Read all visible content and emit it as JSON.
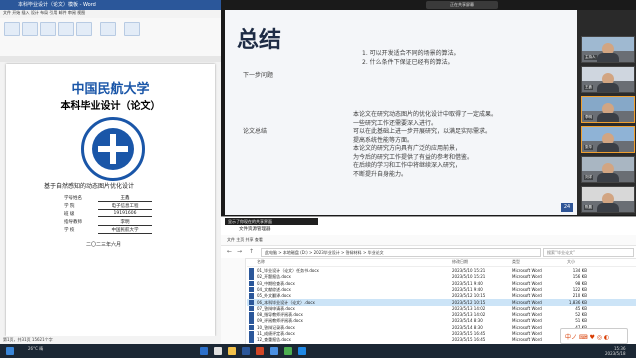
{
  "word": {
    "title": "本科毕业设计（论文）模板 - Word",
    "tabs": "文件 开始 插入 设计 布局 引用 邮件 审阅 视图",
    "university": "中国民航大学",
    "thesis_heading": "本科毕业设计（论文）",
    "doc_title": "基于自然感知的动态图片优化设计",
    "info": [
      {
        "label": "学号姓名",
        "value": "王鑫"
      },
      {
        "label": "学    院",
        "value": "电子信息工程"
      },
      {
        "label": "班    级",
        "value": "19191606"
      },
      {
        "label": "指导教师",
        "value": "李明"
      },
      {
        "label": "学    校",
        "value": "中国民航大学"
      }
    ],
    "date": "二〇二三年六月",
    "status": "第1页，共31页  15621个字"
  },
  "presentation": {
    "indicator": "正在共享屏幕",
    "slide_title": "总结",
    "label_1": "下一步问题",
    "bullets": [
      "1. 可以开发适合不同的场景的算法。",
      "2. 什么条件下保证已经有的算法。"
    ],
    "label_2": "论文总结",
    "para": [
      "本论文在研究动态图片的优化设计中取得了一定成果。",
      "一些研究工作还需要深入进行。",
      "可以在此基础上进一步开展研究，以满足实际需求。",
      "提高系统性能等方面。",
      "本论文的研究方向具有广泛的应用前景，",
      "为今后的研究工作提供了有益的参考和借鉴。",
      "在后续的学习和工作中将继续深入研究，",
      "不断提升自身能力。"
    ],
    "page_num": "24",
    "participants": [
      "主持人",
      "王鑫",
      "李明",
      "张华",
      "刘洋",
      "陈晨"
    ]
  },
  "explorer": {
    "tooltip": "显示了你现在的共享界面",
    "title": "文件资源管理器",
    "tabs": "文件 主页 共享 查看",
    "address": "此电脑 > 本地磁盘 (D:) > 2023毕业设计 > 答辩材料 > 毕业论文",
    "search_placeholder": "搜索“毕业论文”",
    "headers": {
      "name": "名称",
      "date": "修改日期",
      "type": "类型",
      "size": "大小"
    },
    "files": [
      {
        "name": "01_毕业设计（论文）任务书.docx",
        "date": "2023/5/10 15:21",
        "type": "Microsoft Word",
        "size": "134 KB"
      },
      {
        "name": "02_开题报告.docx",
        "date": "2023/5/10 15:21",
        "type": "Microsoft Word",
        "size": "156 KB"
      },
      {
        "name": "03_中期检查表.docx",
        "date": "2023/5/11 9:40",
        "type": "Microsoft Word",
        "size": "98 KB"
      },
      {
        "name": "04_文献综述.docx",
        "date": "2023/5/11 9:40",
        "type": "Microsoft Word",
        "size": "122 KB"
      },
      {
        "name": "05_外文翻译.docx",
        "date": "2023/5/12 10:15",
        "type": "Microsoft Word",
        "size": "210 KB"
      },
      {
        "name": "06_本科毕业设计（论文）.docx",
        "date": "2023/5/12 10:15",
        "type": "Microsoft Word",
        "size": "1,836 KB"
      },
      {
        "name": "07_答辩申请表.docx",
        "date": "2023/5/13 14:02",
        "type": "Microsoft Word",
        "size": "45 KB"
      },
      {
        "name": "08_指导教师评阅表.docx",
        "date": "2023/5/13 14:02",
        "type": "Microsoft Word",
        "size": "52 KB"
      },
      {
        "name": "09_评阅教师评阅表.docx",
        "date": "2023/5/14 8:30",
        "type": "Microsoft Word",
        "size": "51 KB"
      },
      {
        "name": "10_答辩记录表.docx",
        "date": "2023/5/14 8:30",
        "type": "Microsoft Word",
        "size": "47 KB"
      },
      {
        "name": "11_成绩评定表.docx",
        "date": "2023/5/15 16:45",
        "type": "Microsoft Word",
        "size": "49 KB"
      },
      {
        "name": "12_查重报告.docx",
        "date": "2023/5/15 16:45",
        "type": "Microsoft Word",
        "size": "300 KB"
      }
    ],
    "selected_index": 5
  },
  "taskbar": {
    "weather": "26°C 晴",
    "time": "15:36",
    "date": "2023/5/18"
  },
  "ime_label": "中ノ ⌨ ♥ ◎ ◐"
}
